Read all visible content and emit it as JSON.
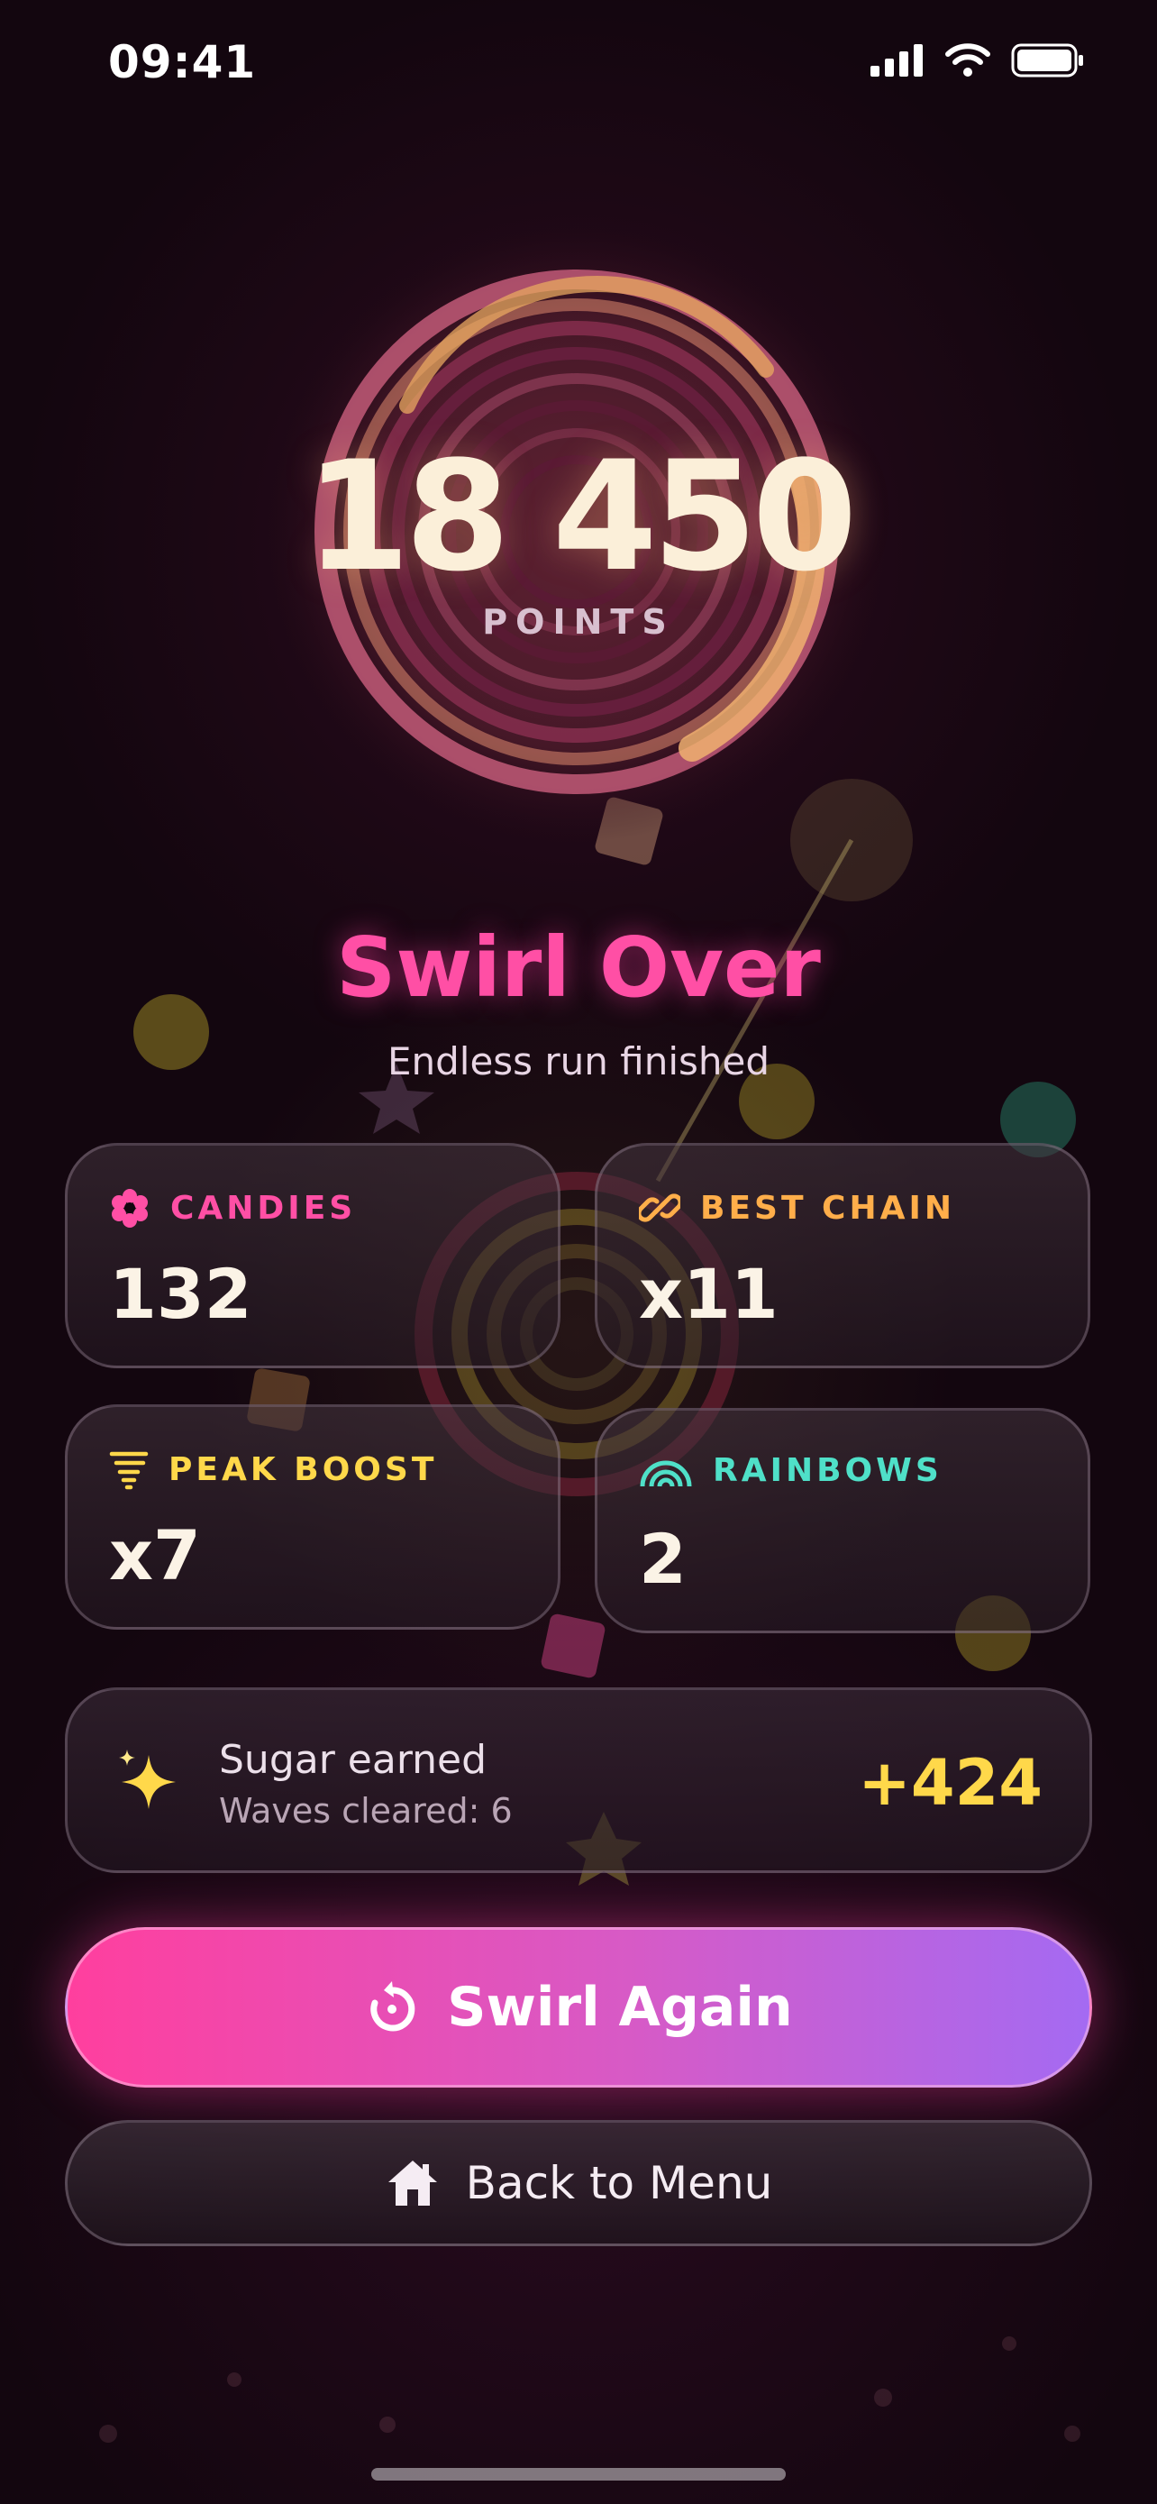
{
  "status_bar": {
    "time": "09:41"
  },
  "score": {
    "value": "18 450",
    "label": "POINTS"
  },
  "result": {
    "title": "Swirl Over",
    "subtitle": "Endless run finished"
  },
  "stats": [
    {
      "label": "CANDIES",
      "value": "132",
      "color": "#ff4fa5",
      "icon": "candy-flower-icon"
    },
    {
      "label": "BEST CHAIN",
      "value": "x11",
      "color": "#ffae4a",
      "icon": "chain-link-icon"
    },
    {
      "label": "PEAK BOOST",
      "value": "x7",
      "color": "#ffd84a",
      "icon": "tornado-icon"
    },
    {
      "label": "RAINBOWS",
      "value": "2",
      "color": "#4fe0c8",
      "icon": "rainbow-icon"
    }
  ],
  "sugar": {
    "title": "Sugar earned",
    "subtitle": "Waves cleared: 6",
    "value": "+424",
    "icon": "sparkles-icon"
  },
  "buttons": {
    "primary": {
      "label": "Swirl Again",
      "icon": "replay-icon"
    },
    "secondary": {
      "label": "Back to Menu",
      "icon": "home-icon"
    }
  },
  "colors": {
    "accent_pink": "#ff4fa5",
    "accent_purple": "#a46af2",
    "gold": "#ffd84a",
    "background": "#13060f"
  }
}
